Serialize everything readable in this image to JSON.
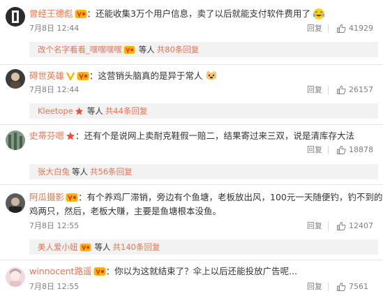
{
  "comments": [
    {
      "username": "曾经王德彪",
      "text": "：还能收集3万个用户信息，卖了以后就能支付软件费用了",
      "text2": "",
      "time": "7月8日 12:44",
      "reply_label": "回复",
      "likes": "41929",
      "sub": {
        "name": "改个名字看看_嘿嘿嘿嘿",
        "etc": "等人",
        "count": "共80条回复"
      }
    },
    {
      "username": "碍世英雄",
      "text": "：这营销头脑真的是异于常人",
      "text2": "",
      "time": "7月8日 12:44",
      "reply_label": "回复",
      "likes": "26157",
      "sub": {
        "name": "Kleetope",
        "etc": "等人",
        "count": "共44条回复"
      }
    },
    {
      "username": "史蒂芬嗯",
      "text": "：还有个是说网上卖耐克鞋假一赔二，结果寄过来三双，说是清库存大法",
      "text2": "",
      "time": "",
      "reply_label": "回复",
      "likes": "18878",
      "sub": {
        "name": "张大白兔",
        "etc": "等人",
        "count": "共56条回复"
      }
    },
    {
      "username": "阿瓜摄影",
      "text": "：有个养鸡厂滞销，旁边有个鱼塘，老板放出风，100元一天随便钓，钓不到的赔",
      "text2": "鸡两只，然后，老板大赚，主要是鱼塘根本没鱼。",
      "time": "7月8日 12:55",
      "reply_label": "回复",
      "likes": "12407",
      "sub": {
        "name": "美人爱小妞",
        "etc": "等人",
        "count": "共140条回复"
      }
    },
    {
      "username": "winnocent路遥",
      "text": "：你以为这就结束了？伞上以后还能投放广告呢...",
      "text2": "",
      "time": "7月8日 12:55",
      "reply_label": "回复",
      "likes": "7561",
      "sub": null
    }
  ],
  "colors": {
    "username": "#eb7350",
    "meta": "#808080",
    "subbg": "#f2f2f2"
  },
  "icons": [
    "avatar",
    "vip-badge-icon",
    "star-badge-icon",
    "v-verified-icon",
    "laugh-emoji-icon",
    "doge-emoji-icon",
    "thumbs-up-icon"
  ]
}
